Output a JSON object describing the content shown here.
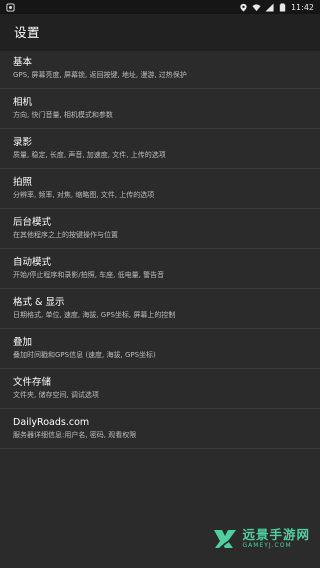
{
  "status_bar": {
    "time": "11:42",
    "left_icon": "android-app-icon",
    "icons": [
      "location-icon",
      "wifi-icon",
      "signal-icon",
      "battery-icon"
    ]
  },
  "toolbar": {
    "title": "设置"
  },
  "settings": [
    {
      "title": "基本",
      "subtitle": "GPS, 屏幕亮度, 屏幕锁, 返回按键, 地址, 漫游, 过热保护"
    },
    {
      "title": "相机",
      "subtitle": "方向, 快门音量, 相机模式和参数"
    },
    {
      "title": "录影",
      "subtitle": "质量, 稳定, 长度, 声音, 加速度, 文件, 上传的选项"
    },
    {
      "title": "拍照",
      "subtitle": "分辨率, 频率, 对焦, 缩略图, 文件, 上传的选项"
    },
    {
      "title": "后台模式",
      "subtitle": "在其他程序之上的按键操作与位置"
    },
    {
      "title": "自动模式",
      "subtitle": "开始/停止程序和录影/拍照, 车座, 低电量, 警告音"
    },
    {
      "title": "格式 & 显示",
      "subtitle": "日期格式, 单位, 速度, 海拔, GPS坐标, 屏幕上的控制"
    },
    {
      "title": "叠加",
      "subtitle": "叠加时间戳和GPS信息 (速度, 海拔, GPS坐标)"
    },
    {
      "title": "文件存储",
      "subtitle": "文件夹, 储存空间, 调试选项"
    },
    {
      "title": "DailyRoads.com",
      "subtitle": "服务器详细信息:用户名, 密码, 观看权限"
    }
  ],
  "watermark": {
    "main": "远景手游网",
    "sub": "GAMEYJ.COM",
    "color": "#4fd0a0"
  }
}
